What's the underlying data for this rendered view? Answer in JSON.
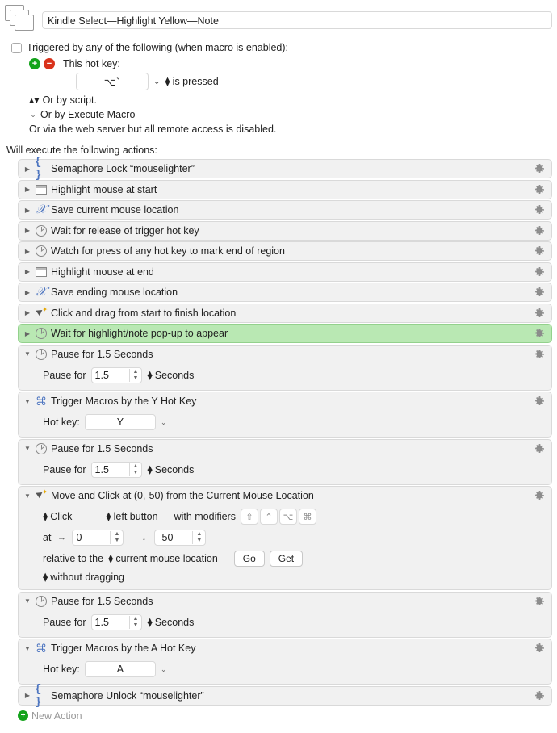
{
  "title": "Kindle Select—Highlight Yellow—Note",
  "triggers": {
    "header": "Triggered by any of the following (when macro is enabled):",
    "this_hot_key": "This hot key:",
    "hotkey_shortcut": "⌥`",
    "hotkey_cond": "is pressed",
    "or_script": "Or by script.",
    "or_exec_macro": "Or by Execute Macro",
    "or_web": "Or via the web server but all remote access is disabled."
  },
  "exec_label": "Will execute the following actions:",
  "labels": {
    "pause_for": "Pause for",
    "seconds": "Seconds",
    "hotkey": "Hot key:",
    "click": "Click",
    "left_button": "left button",
    "with_modifiers": "with modifiers",
    "at": "at",
    "relative_to": "relative to the",
    "cur_mouse_loc": "current mouse location",
    "without_drag": "without dragging",
    "go": "Go",
    "get": "Get"
  },
  "actions": [
    {
      "title": "Semaphore Lock “mouselighter”",
      "icon": "brace"
    },
    {
      "title": "Highlight mouse at start",
      "icon": "window"
    },
    {
      "title": "Save current mouse location",
      "icon": "var"
    },
    {
      "title": "Wait for release of trigger hot key",
      "icon": "clock"
    },
    {
      "title": "Watch for press of any hot key to mark end of region",
      "icon": "clock"
    },
    {
      "title": "Highlight mouse at end",
      "icon": "window"
    },
    {
      "title": "Save ending mouse location",
      "icon": "var"
    },
    {
      "title": "Click and drag from start to finish location",
      "icon": "cursor"
    },
    {
      "title": "Wait for highlight/note pop-up to appear",
      "icon": "clock",
      "highlight": true
    },
    {
      "title": "Pause for 1.5 Seconds",
      "icon": "clock",
      "body": "pause",
      "pause_val": "1.5"
    },
    {
      "title": "Trigger Macros by the Y Hot Key",
      "icon": "cmd",
      "body": "hotkey",
      "hotkey_val": "Y"
    },
    {
      "title": "Pause for 1.5 Seconds",
      "icon": "clock",
      "body": "pause",
      "pause_val": "1.5"
    },
    {
      "title": "Move and Click at (0,-50) from the Current Mouse Location",
      "icon": "cursor",
      "body": "moveclick",
      "dx": "0",
      "dy": "-50"
    },
    {
      "title": "Pause for 1.5 Seconds",
      "icon": "clock",
      "body": "pause",
      "pause_val": "1.5"
    },
    {
      "title": "Trigger Macros by the A Hot Key",
      "icon": "cmd",
      "body": "hotkey",
      "hotkey_val": "A"
    },
    {
      "title": "Semaphore Unlock “mouselighter”",
      "icon": "brace"
    }
  ],
  "footer": {
    "new_action": "New Action"
  }
}
